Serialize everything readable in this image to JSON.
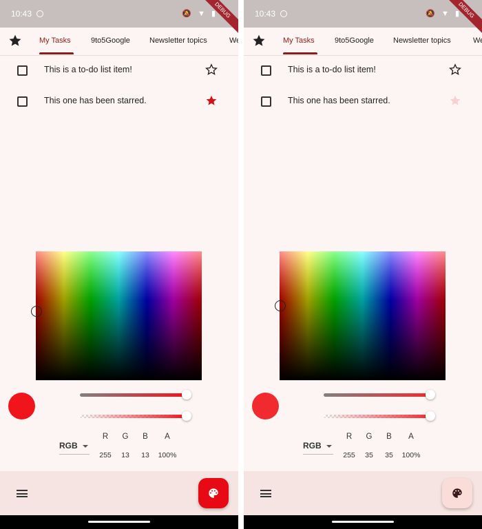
{
  "screens": [
    {
      "status": {
        "time": "10:43",
        "icons": "🔕 ▼ ▮",
        "debug": "DEBUG"
      },
      "tabs": [
        "My Tasks",
        "9to5Google",
        "Newsletter topics",
        "We"
      ],
      "tasks": [
        {
          "text": "This is a to-do list item!",
          "starred": false
        },
        {
          "text": "This one has been starred.",
          "starred": true
        }
      ],
      "picker": {
        "mode": "RGB",
        "channel_labels": [
          "R",
          "G",
          "B",
          "A"
        ],
        "values": [
          "255",
          "13",
          "13",
          "100%"
        ],
        "color": "#f0141b",
        "fab_color": "#e70a14",
        "star_color": "#d0121a"
      }
    },
    {
      "status": {
        "time": "10:43",
        "icons": "🔕 ▼ ▮",
        "debug": "DEBUG"
      },
      "tabs": [
        "My Tasks",
        "9to5Google",
        "Newsletter topics",
        "We"
      ],
      "tasks": [
        {
          "text": "This is a to-do list item!",
          "starred": false
        },
        {
          "text": "This one has been starred.",
          "starred": true
        }
      ],
      "picker": {
        "mode": "RGB",
        "channel_labels": [
          "R",
          "G",
          "B",
          "A"
        ],
        "values": [
          "255",
          "35",
          "35",
          "100%"
        ],
        "color": "#f02a2f",
        "fab_color": "#fadcd8",
        "star_color": "#f7d0d1"
      }
    }
  ]
}
